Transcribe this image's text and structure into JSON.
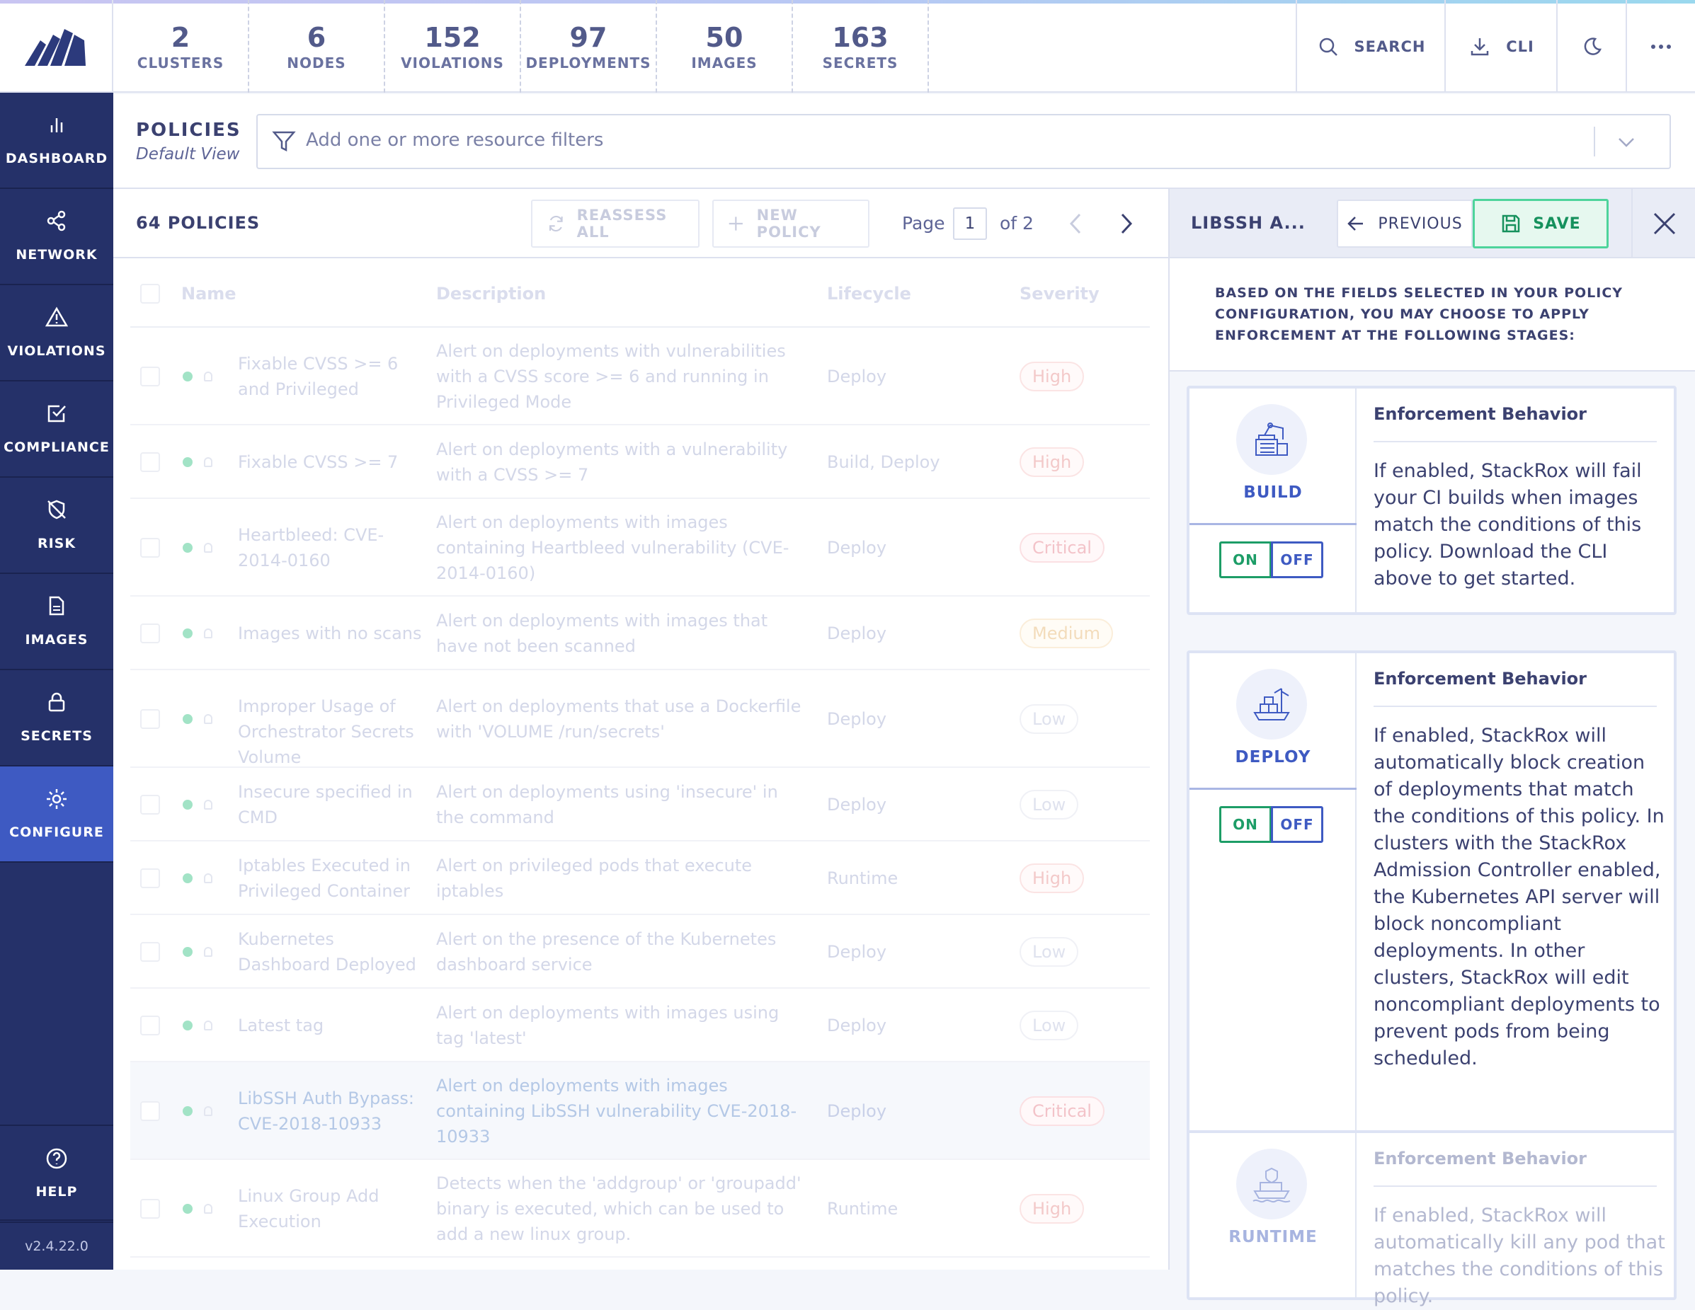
{
  "stats": [
    {
      "value": "2",
      "label": "CLUSTERS"
    },
    {
      "value": "6",
      "label": "NODES"
    },
    {
      "value": "152",
      "label": "VIOLATIONS"
    },
    {
      "value": "97",
      "label": "DEPLOYMENTS"
    },
    {
      "value": "50",
      "label": "IMAGES"
    },
    {
      "value": "163",
      "label": "SECRETS"
    }
  ],
  "topbar": {
    "search_label": "SEARCH",
    "cli_label": "CLI"
  },
  "nav": {
    "items": [
      {
        "label": "DASHBOARD",
        "icon": "bar-chart-icon"
      },
      {
        "label": "NETWORK",
        "icon": "share-icon"
      },
      {
        "label": "VIOLATIONS",
        "icon": "alert-triangle-icon"
      },
      {
        "label": "COMPLIANCE",
        "icon": "check-square-icon"
      },
      {
        "label": "RISK",
        "icon": "shield-off-icon"
      },
      {
        "label": "IMAGES",
        "icon": "file-icon"
      },
      {
        "label": "SECRETS",
        "icon": "lock-icon"
      },
      {
        "label": "CONFIGURE",
        "icon": "gear-icon",
        "active": true
      }
    ],
    "help_label": "HELP",
    "version": "v2.4.22.0"
  },
  "page": {
    "title": "POLICIES",
    "view": "Default View",
    "filter_placeholder": "Add one or more resource filters"
  },
  "list": {
    "count_label": "64 POLICIES",
    "reassess_label": "REASSESS ALL",
    "new_policy_label": "NEW POLICY",
    "page_label": "Page",
    "page_value": "1",
    "page_of": "of 2",
    "columns": [
      "Name",
      "Description",
      "Lifecycle",
      "Severity"
    ],
    "rows": [
      {
        "name": "Fixable CVSS >= 6 and Privileged",
        "description": "Alert on deployments with vulnerabilities with a CVSS score >= 6 and running in Privileged Mode",
        "lifecycle": "Deploy",
        "severity": "High"
      },
      {
        "name": "Fixable CVSS >= 7",
        "description": "Alert on deployments with a vulnerability with a CVSS >= 7",
        "lifecycle": "Build, Deploy",
        "severity": "High"
      },
      {
        "name": "Heartbleed: CVE-2014-0160",
        "description": "Alert on deployments with images containing Heartbleed vulnerability (CVE-2014-0160)",
        "lifecycle": "Deploy",
        "severity": "Critical"
      },
      {
        "name": "Images with no scans",
        "description": "Alert on deployments with images that have not been scanned",
        "lifecycle": "Deploy",
        "severity": "Medium"
      },
      {
        "name": "Improper Usage of Orchestrator Secrets Volume",
        "description": "Alert on deployments that use a Dockerfile with 'VOLUME /run/secrets'",
        "lifecycle": "Deploy",
        "severity": "Low"
      },
      {
        "name": "Insecure specified in CMD",
        "description": "Alert on deployments using 'insecure' in the command",
        "lifecycle": "Deploy",
        "severity": "Low"
      },
      {
        "name": "Iptables Executed in Privileged Container",
        "description": "Alert on privileged pods that execute iptables",
        "lifecycle": "Runtime",
        "severity": "High"
      },
      {
        "name": "Kubernetes Dashboard Deployed",
        "description": "Alert on the presence of the Kubernetes dashboard service",
        "lifecycle": "Deploy",
        "severity": "Low"
      },
      {
        "name": "Latest tag",
        "description": "Alert on deployments with images using tag 'latest'",
        "lifecycle": "Deploy",
        "severity": "Low"
      },
      {
        "name": "LibSSH Auth Bypass: CVE-2018-10933",
        "description": "Alert on deployments with images containing LibSSH vulnerability CVE-2018-10933",
        "lifecycle": "Deploy",
        "severity": "Critical",
        "selected": true
      },
      {
        "name": "Linux Group Add Execution",
        "description": "Detects when the 'addgroup' or 'groupadd' binary is executed, which can be used to add a new linux group.",
        "lifecycle": "Runtime",
        "severity": "High"
      }
    ]
  },
  "panel": {
    "title": "LIBSSH A...",
    "previous_label": "PREVIOUS",
    "save_label": "SAVE",
    "intro": "Based on the fields selected in your policy configuration, you may choose to apply enforcement at the following stages:",
    "stages": [
      {
        "name": "BUILD",
        "icon": "build-stage-icon",
        "heading": "Enforcement Behavior",
        "on": "ON",
        "off": "OFF",
        "text": "If enabled, StackRox will fail your CI builds when images match the conditions of this policy. Download the CLI above to get started."
      },
      {
        "name": "DEPLOY",
        "icon": "deploy-stage-icon",
        "heading": "Enforcement Behavior",
        "on": "ON",
        "off": "OFF",
        "text": "If enabled, StackRox will automatically block creation of deployments that match the conditions of this policy. In clusters with the StackRox Admission Controller enabled, the Kubernetes API server will block noncompliant deployments. In other clusters, StackRox will edit noncompliant deployments to prevent pods from being scheduled."
      },
      {
        "name": "RUNTIME",
        "icon": "runtime-stage-icon",
        "heading": "Enforcement Behavior",
        "text": "If enabled, StackRox will automatically kill any pod that matches the conditions of this policy."
      }
    ]
  }
}
